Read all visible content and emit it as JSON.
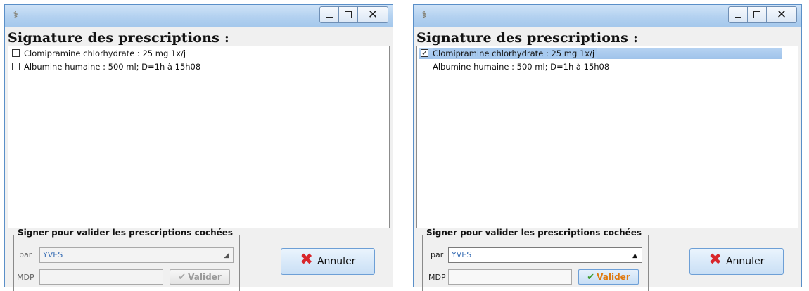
{
  "windows": [
    {
      "heading": "Signature des prescriptions :",
      "items": [
        {
          "label": "Clomipramine chlorhydrate : 25 mg 1x/j",
          "checked": false,
          "selected": false
        },
        {
          "label": "Albumine humaine : 500 ml; D=1h à 15h08",
          "checked": false,
          "selected": false
        }
      ],
      "sign_group_title": "Signer pour valider les prescriptions cochées",
      "par_label": "par",
      "par_value": "YVES",
      "mdp_label": "MDP",
      "mdp_value": "",
      "valider_label": "Valider",
      "valider_enabled": false,
      "annuler_label": "Annuler"
    },
    {
      "heading": "Signature des prescriptions :",
      "items": [
        {
          "label": "Clomipramine chlorhydrate : 25 mg 1x/j",
          "checked": true,
          "selected": true
        },
        {
          "label": "Albumine humaine : 500 ml; D=1h à 15h08",
          "checked": false,
          "selected": false
        }
      ],
      "sign_group_title": "Signer pour valider les prescriptions cochées",
      "par_label": "par",
      "par_value": "YVES",
      "mdp_label": "MDP",
      "mdp_value": "",
      "valider_label": "Valider",
      "valider_enabled": true,
      "annuler_label": "Annuler"
    }
  ],
  "titlebar": {
    "icon": "doctor-app-icon",
    "buttons": [
      "minimize",
      "maximize",
      "close"
    ]
  },
  "colors": {
    "titlebar": "#b3d1f0",
    "selection": "#a7c9ee",
    "annuler_icon": "#d8262b",
    "valider_active_text": "#e07a10",
    "valider_check": "#3c9a2e"
  }
}
